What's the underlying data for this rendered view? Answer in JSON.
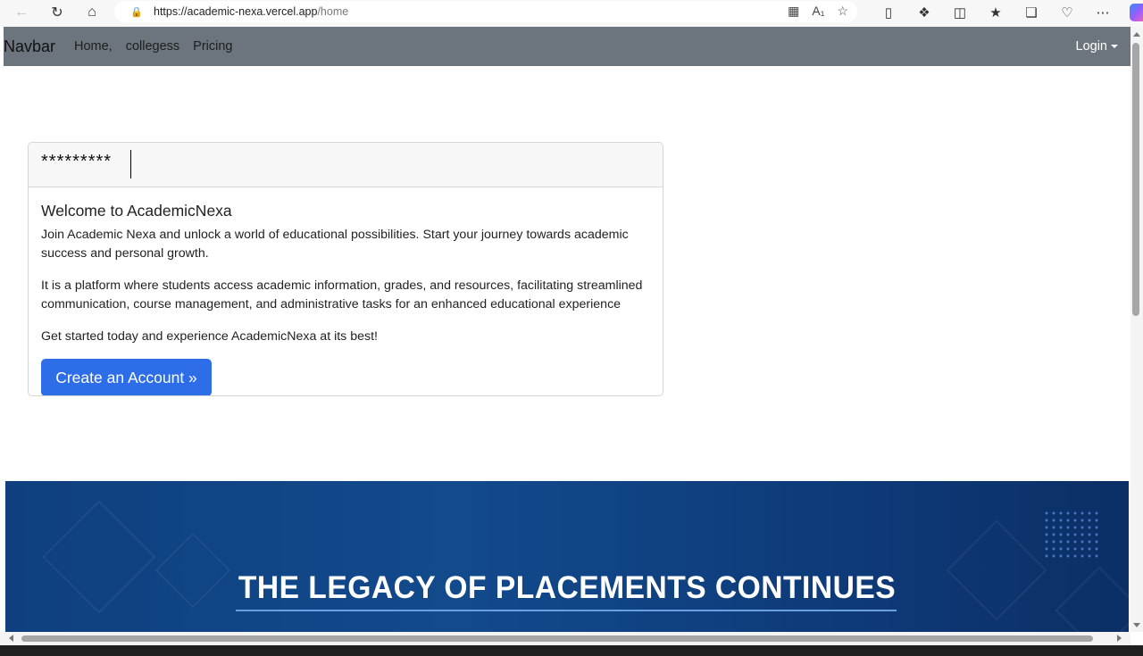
{
  "browser": {
    "url_host": "https://academic-nexa.vercel.app",
    "url_path": "/home"
  },
  "navbar": {
    "brand": "Navbar",
    "links": [
      "Home,",
      "collegess",
      "Pricing"
    ],
    "login_label": "Login"
  },
  "card": {
    "password_value": "*********",
    "title": "Welcome to AcademicNexa",
    "paragraph1": "Join Academic Nexa and unlock a world of educational possibilities. Start your journey towards academic success and personal growth.",
    "paragraph2": "It is a platform where students access academic information, grades, and resources, facilitating streamlined communication, course management, and administrative tasks for an enhanced educational experience",
    "paragraph3": "Get started today and experience AcademicNexa at its best!",
    "cta_label": "Create an Account »"
  },
  "banner": {
    "title": "THE LEGACY OF PLACEMENTS CONTINUES"
  },
  "colors": {
    "navbar_bg": "#6c757d",
    "primary_button": "#2d6de8",
    "banner_bg": "#124a8c"
  }
}
